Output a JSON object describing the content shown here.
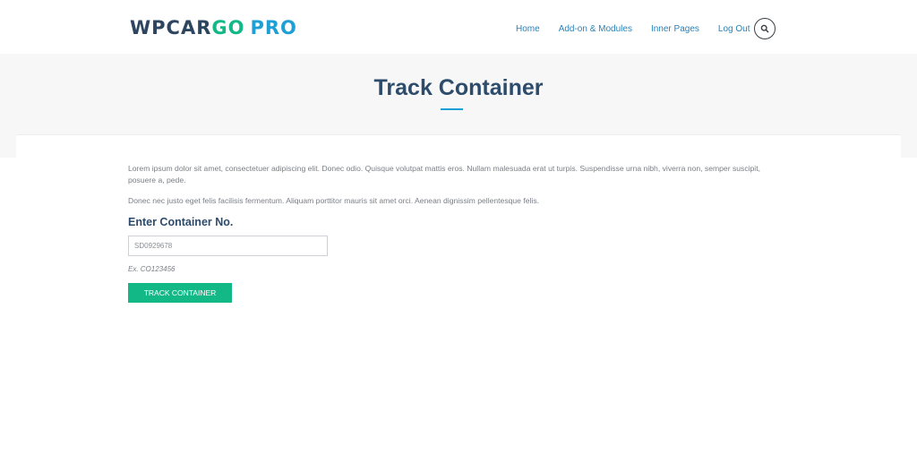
{
  "header": {
    "logo": {
      "part1": "WPCAR",
      "part2": "GO",
      "part3": "PRO"
    },
    "nav": [
      {
        "label": "Home"
      },
      {
        "label": "Add-on & Modules"
      },
      {
        "label": "Inner Pages"
      },
      {
        "label": "Log Out"
      }
    ],
    "search_icon": "search-icon"
  },
  "page": {
    "title": "Track Container"
  },
  "content": {
    "paragraph1": "Lorem ipsum dolor sit amet, consectetuer adipiscing elit. Donec odio. Quisque volutpat mattis eros. Nullam malesuada erat ut turpis. Suspendisse urna nibh, viverra non, semper suscipit, posuere a, pede.",
    "paragraph2": "Donec nec justo eget felis facilisis fermentum. Aliquam porttitor mauris sit amet orci. Aenean dignissim pellentesque felis.",
    "form_heading": "Enter Container No.",
    "input_value": "SD0929678",
    "hint": "Ex. CO123456",
    "button_label": "TRACK CONTAINER"
  },
  "colors": {
    "accent_green": "#12b886",
    "accent_blue": "#1e9fd6",
    "title_navy": "#2d4b6b"
  }
}
